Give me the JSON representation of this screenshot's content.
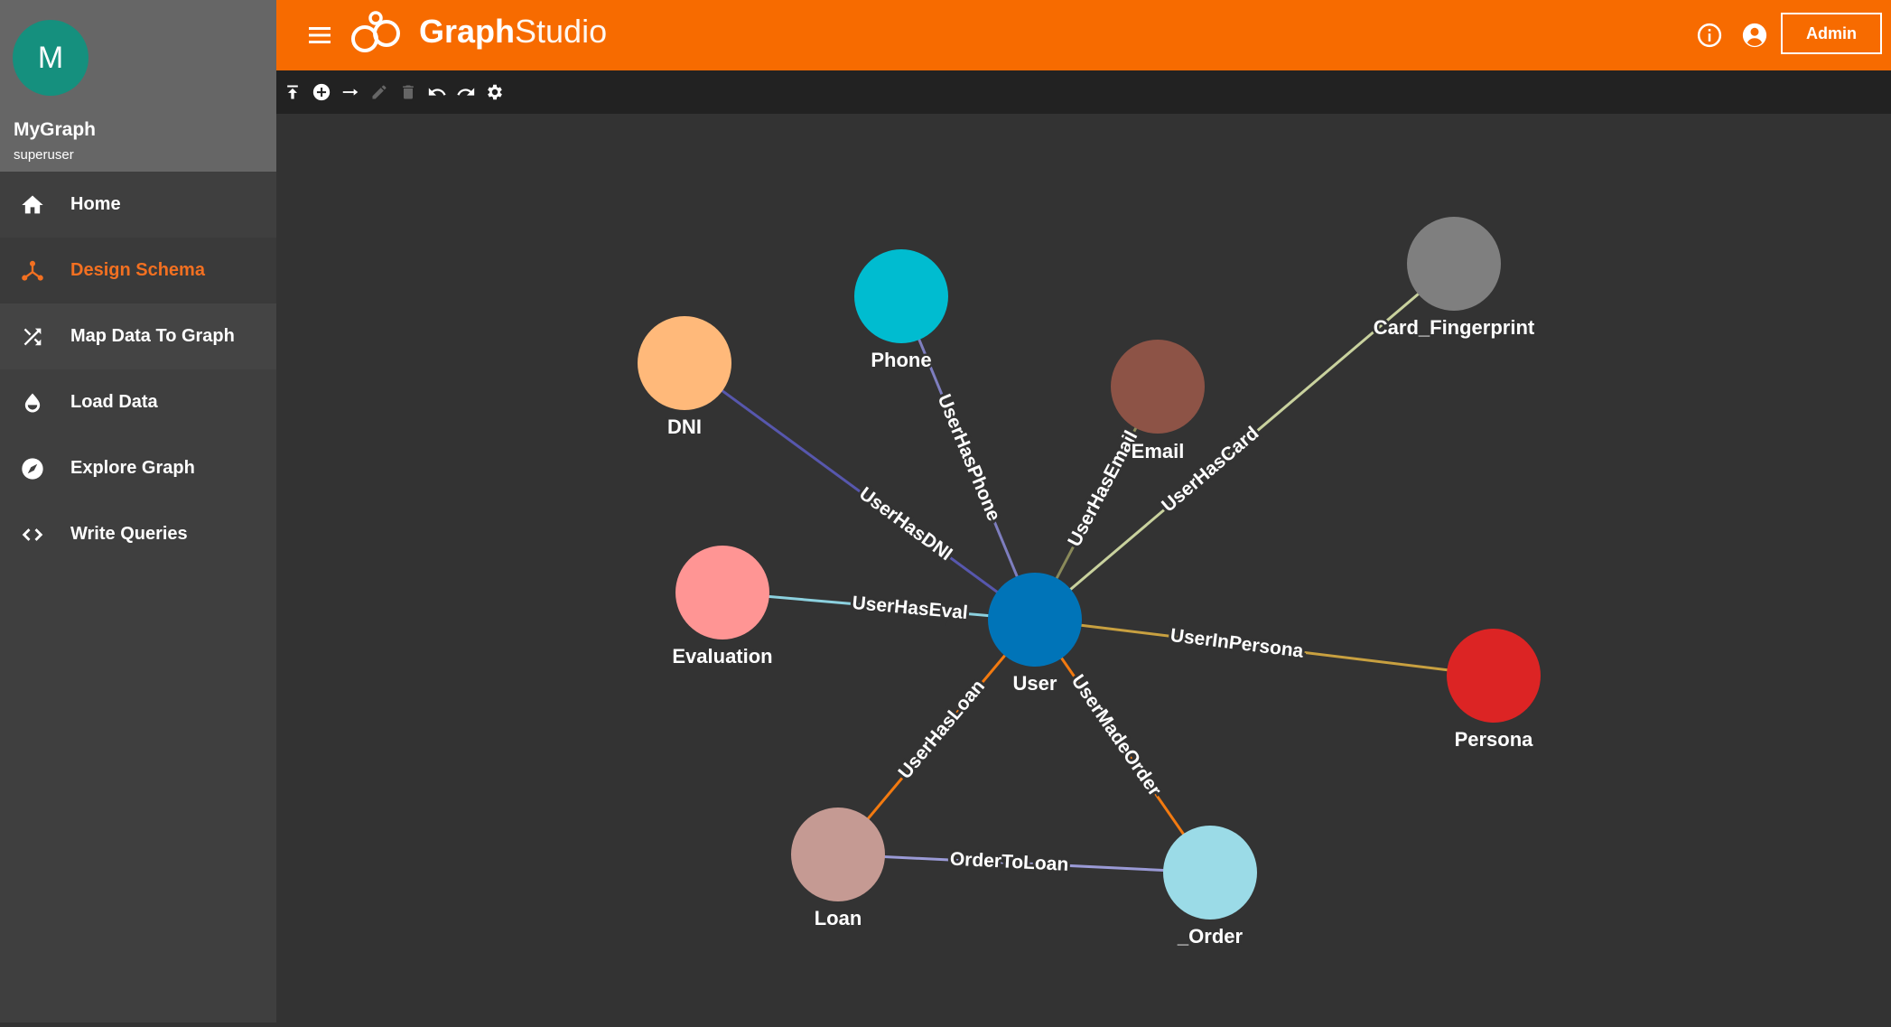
{
  "sidebar": {
    "avatar_letter": "M",
    "graph_name": "MyGraph",
    "role": "superuser",
    "items": [
      {
        "label": "Home",
        "icon": "home-icon"
      },
      {
        "label": "Design Schema",
        "icon": "schema-icon"
      },
      {
        "label": "Map Data To Graph",
        "icon": "shuffle-icon"
      },
      {
        "label": "Load Data",
        "icon": "drop-icon"
      },
      {
        "label": "Explore Graph",
        "icon": "compass-icon"
      },
      {
        "label": "Write Queries",
        "icon": "code-icon"
      }
    ],
    "active_item": "Design Schema"
  },
  "header": {
    "title_bold": "Graph",
    "title_light": "Studio",
    "admin_label": "Admin"
  },
  "toolbar": {
    "tools": [
      "upload-icon",
      "add-vertex-icon",
      "add-edge-icon",
      "edit-icon",
      "delete-icon",
      "undo-icon",
      "redo-icon",
      "settings-icon"
    ]
  },
  "schema": {
    "vertices": [
      {
        "id": "User",
        "label": "User",
        "color": "#0074b8"
      },
      {
        "id": "Phone",
        "label": "Phone",
        "color": "#00bcd0"
      },
      {
        "id": "DNI",
        "label": "DNI",
        "color": "#ffb97a"
      },
      {
        "id": "Email",
        "label": "Email",
        "color": "#8d5346"
      },
      {
        "id": "Card_Fingerprint",
        "label": "Card_Fingerprint",
        "color": "#7f7f7f"
      },
      {
        "id": "Evaluation",
        "label": "Evaluation",
        "color": "#ff9594"
      },
      {
        "id": "Persona",
        "label": "Persona",
        "color": "#dc2424"
      },
      {
        "id": "Loan",
        "label": "Loan",
        "color": "#c59a93"
      },
      {
        "id": "_Order",
        "label": "_Order",
        "color": "#9bdbe7"
      }
    ],
    "edges": [
      {
        "label": "UserHasDNI",
        "from": "User",
        "to": "DNI",
        "color": "#5757ad"
      },
      {
        "label": "UserHasPhone",
        "from": "User",
        "to": "Phone",
        "color": "#7e7ebf"
      },
      {
        "label": "UserHasEmail",
        "from": "User",
        "to": "Email",
        "color": "#8a8a5a"
      },
      {
        "label": "UserHasCard",
        "from": "User",
        "to": "Card_Fingerprint",
        "color": "#c9d29e"
      },
      {
        "label": "UserHasEval",
        "from": "User",
        "to": "Evaluation",
        "color": "#8cd1df"
      },
      {
        "label": "UserInPersona",
        "from": "User",
        "to": "Persona",
        "color": "#c8a040"
      },
      {
        "label": "UserHasLoan",
        "from": "User",
        "to": "Loan",
        "color": "#f37a10"
      },
      {
        "label": "UserMadeOrder",
        "from": "User",
        "to": "_Order",
        "color": "#f37a10"
      },
      {
        "label": "OrderToLoan",
        "from": "Loan",
        "to": "_Order",
        "color": "#9a9ad6"
      }
    ]
  }
}
